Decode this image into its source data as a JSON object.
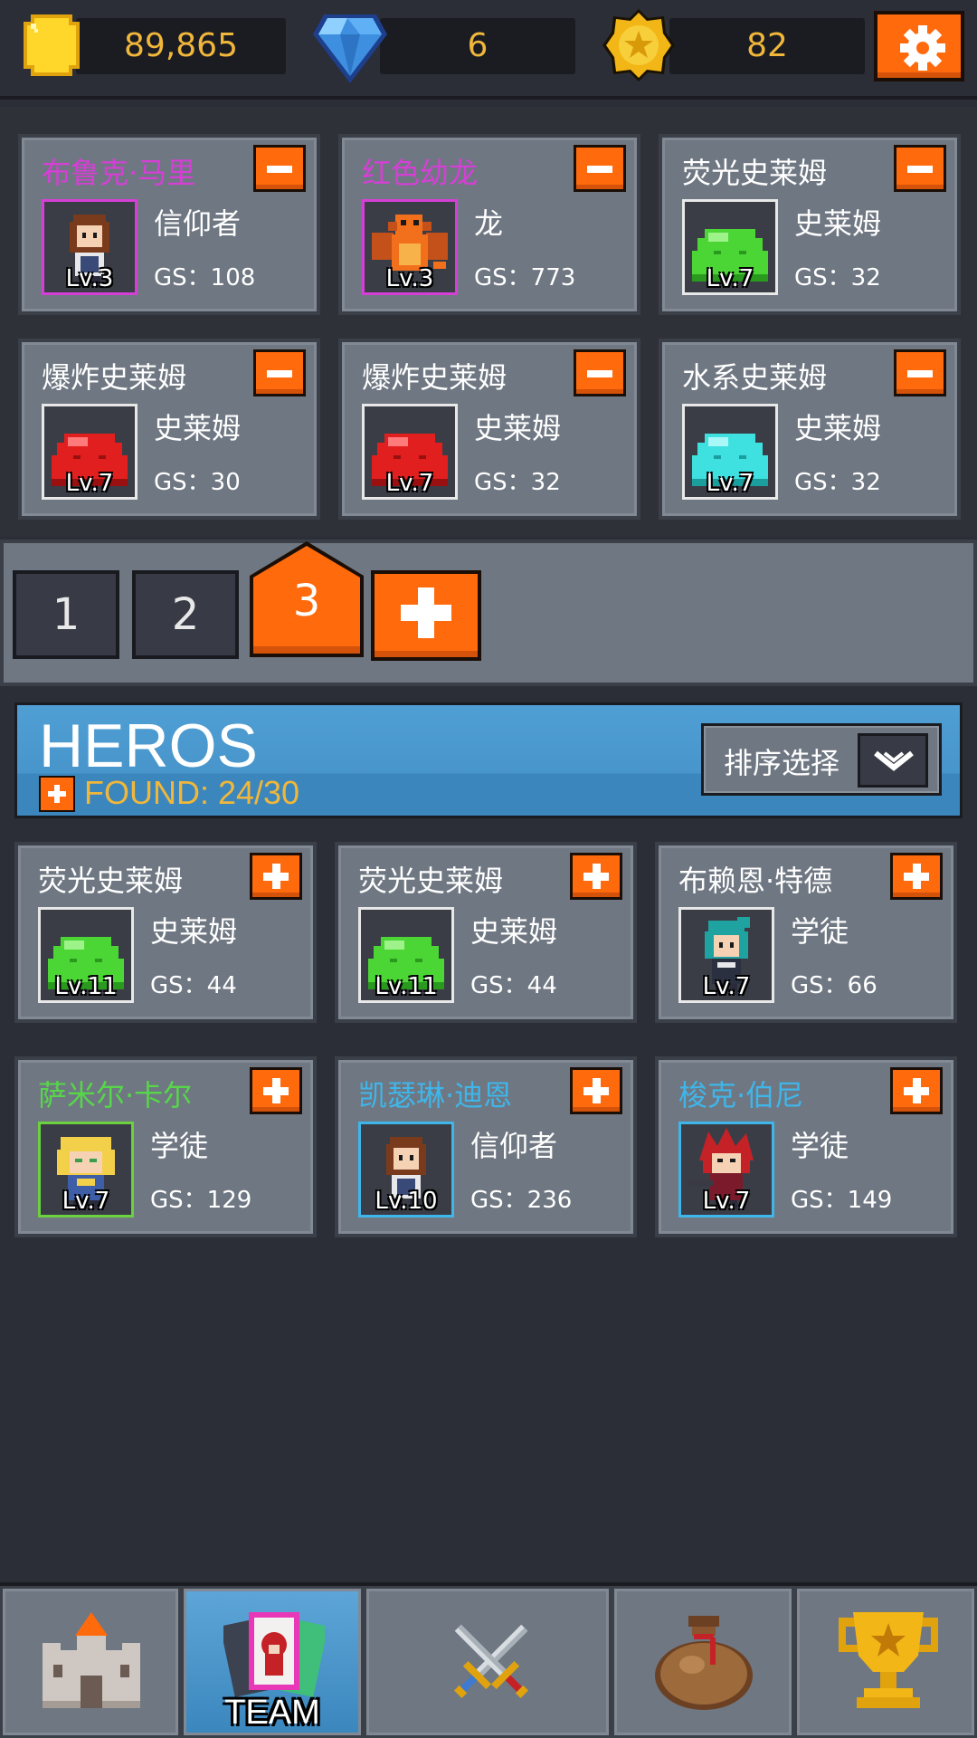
{
  "currency": {
    "gold": "89,865",
    "gems": "6",
    "stars": "82"
  },
  "team": {
    "members": [
      {
        "name": "布鲁克·马里",
        "name_color": "#d63fd6",
        "class": "信仰者",
        "level": "Lv.3",
        "gs": "GS：108",
        "frame_color": "#d63fd6",
        "sprite": "girl-brown-hair"
      },
      {
        "name": "红色幼龙",
        "name_color": "#d63fd6",
        "class": "龙",
        "level": "Lv.3",
        "gs": "GS：773",
        "frame_color": "#d63fd6",
        "sprite": "orange-dragon"
      },
      {
        "name": "荧光史莱姆",
        "name_color": "#ffffff",
        "class": "史莱姆",
        "level": "Lv.7",
        "gs": "GS：32",
        "frame_color": "#e8e8e8",
        "sprite": "green-slime"
      },
      {
        "name": "爆炸史莱姆",
        "name_color": "#ffffff",
        "class": "史莱姆",
        "level": "Lv.7",
        "gs": "GS：30",
        "frame_color": "#e8e8e8",
        "sprite": "red-slime"
      },
      {
        "name": "爆炸史莱姆",
        "name_color": "#ffffff",
        "class": "史莱姆",
        "level": "Lv.7",
        "gs": "GS：32",
        "frame_color": "#e8e8e8",
        "sprite": "red-slime"
      },
      {
        "name": "水系史莱姆",
        "name_color": "#ffffff",
        "class": "史莱姆",
        "level": "Lv.7",
        "gs": "GS：32",
        "frame_color": "#e8e8e8",
        "sprite": "cyan-slime"
      }
    ]
  },
  "tabs": {
    "items": [
      "1",
      "2",
      "3"
    ],
    "active": "3"
  },
  "heroes": {
    "title": "HEROS",
    "found": "FOUND: 24/30",
    "sort_label": "排序选择",
    "list": [
      {
        "name": "荧光史莱姆",
        "name_color": "#ffffff",
        "class": "史莱姆",
        "level": "Lv.11",
        "gs": "GS：44",
        "frame_color": "#e8e8e8",
        "sprite": "green-slime"
      },
      {
        "name": "荧光史莱姆",
        "name_color": "#ffffff",
        "class": "史莱姆",
        "level": "Lv.11",
        "gs": "GS：44",
        "frame_color": "#e8e8e8",
        "sprite": "green-slime"
      },
      {
        "name": "布赖恩·特德",
        "name_color": "#ffffff",
        "class": "学徒",
        "level": "Lv.7",
        "gs": "GS：66",
        "frame_color": "#e8e8e8",
        "sprite": "teal-hair-girl"
      },
      {
        "name": "萨米尔·卡尔",
        "name_color": "#57d64a",
        "class": "学徒",
        "level": "Lv.7",
        "gs": "GS：129",
        "frame_color": "#6bd13f",
        "sprite": "blonde-hero"
      },
      {
        "name": "凯瑟琳·迪恩",
        "name_color": "#3fb6ea",
        "class": "信仰者",
        "level": "Lv.10",
        "gs": "GS：236",
        "frame_color": "#3fb6ea",
        "sprite": "girl-brown-hair"
      },
      {
        "name": "梭克·伯尼",
        "name_color": "#3fb6ea",
        "class": "学徒",
        "level": "Lv.7",
        "gs": "GS：149",
        "frame_color": "#3fb6ea",
        "sprite": "red-hair-warrior"
      }
    ]
  },
  "nav": {
    "items": [
      {
        "icon": "castle-icon"
      },
      {
        "icon": "team-cards-icon",
        "label": "TEAM",
        "active": true
      },
      {
        "icon": "crossed-swords-icon"
      },
      {
        "icon": "loot-bag-icon"
      },
      {
        "icon": "trophy-icon"
      }
    ]
  },
  "colors": {
    "accent": "#ff6a0c",
    "currency_text": "#f0b73a",
    "header_blue": "#4795cb",
    "card_bg": "#6f7782",
    "page_bg": "#2b2d37"
  }
}
